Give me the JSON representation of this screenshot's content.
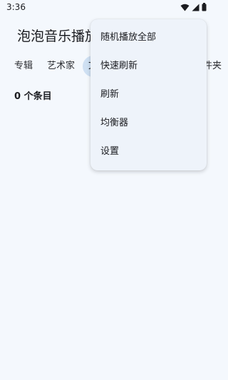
{
  "status_bar": {
    "time": "3:36",
    "icons": [
      "wifi-icon",
      "signal-icon",
      "battery-icon"
    ]
  },
  "app": {
    "title": "泡泡音乐播放器"
  },
  "tabs": [
    {
      "label": "专辑"
    },
    {
      "label": "艺术家"
    },
    {
      "label": "文件夹",
      "active": true
    },
    {
      "label": "文件夹"
    }
  ],
  "content": {
    "item_count": "0 个条目"
  },
  "menu": {
    "items": [
      {
        "label": "随机播放全部"
      },
      {
        "label": "快速刷新"
      },
      {
        "label": "刷新"
      },
      {
        "label": "均衡器"
      },
      {
        "label": "设置"
      }
    ]
  },
  "colors": {
    "background": "#f4f8fd",
    "menu_background": "#eef3fa",
    "active_tab": "#cfe0f3",
    "text": "#1b1c20"
  }
}
